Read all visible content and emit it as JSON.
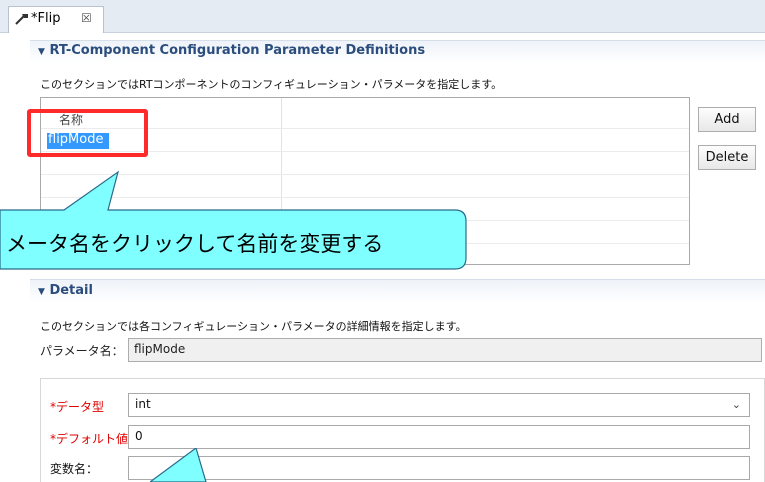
{
  "editor_tab": {
    "title": "*Flip",
    "close_glyph": "☒"
  },
  "config_section": {
    "title": "RT-Component Configuration Parameter Definitions",
    "description": "このセクションではRTコンポーネントのコンフィギュレーション・パラメータを指定します。",
    "table": {
      "column_header": "名称",
      "rows": [
        {
          "name": "flipMode"
        }
      ]
    },
    "add_label": "Add",
    "delete_label": "Delete"
  },
  "callout": {
    "text": "メータ名をクリックして名前を変更する",
    "fill_color": "#7fffff",
    "highlight_color": "#ff2a2a"
  },
  "detail_section": {
    "title": "Detail",
    "description": "このセクションでは各コンフィギュレーション・パラメータの詳細情報を指定します。",
    "param_name_label": "パラメータ名：",
    "param_name_value": "flipMode",
    "datatype_label": "*データ型",
    "datatype_value": "int",
    "default_label": "*デフォルト値",
    "default_value": "0",
    "varname_label": "変数名：",
    "varname_value": ""
  },
  "colors": {
    "section_title": "#2b4d7e",
    "selection": "#3399ff",
    "required_label": "#e00000"
  }
}
